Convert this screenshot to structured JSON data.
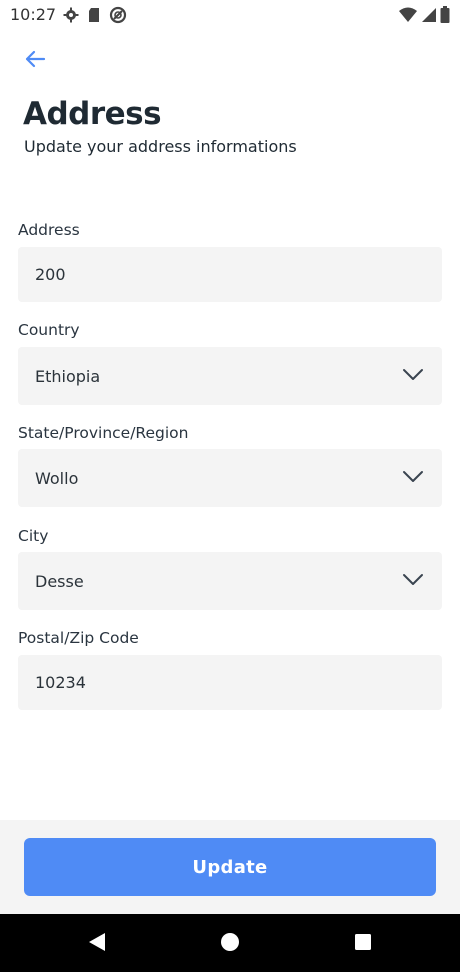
{
  "status_bar": {
    "time": "10:27",
    "left_icons": [
      "settings-icon",
      "sd-card-icon",
      "data-saver-icon"
    ],
    "right_icons": [
      "wifi-icon",
      "cell-signal-icon",
      "battery-icon"
    ]
  },
  "header": {
    "back_icon": "arrow-left-icon",
    "title": "Address",
    "subtitle": "Update your address informations"
  },
  "form": {
    "address": {
      "label": "Address",
      "value": "200"
    },
    "country": {
      "label": "Country",
      "value": "Ethiopia"
    },
    "state": {
      "label": "State/Province/Region",
      "value": "Wollo"
    },
    "city": {
      "label": "City",
      "value": "Desse"
    },
    "postal": {
      "label": "Postal/Zip Code",
      "value": "10234"
    }
  },
  "footer": {
    "update_label": "Update"
  },
  "colors": {
    "accent": "#4f8bf5",
    "field_bg": "#f4f4f4",
    "text": "#1f2a33"
  },
  "nav_bar": {
    "icons": [
      "back-triangle-icon",
      "home-circle-icon",
      "recents-square-icon"
    ]
  }
}
